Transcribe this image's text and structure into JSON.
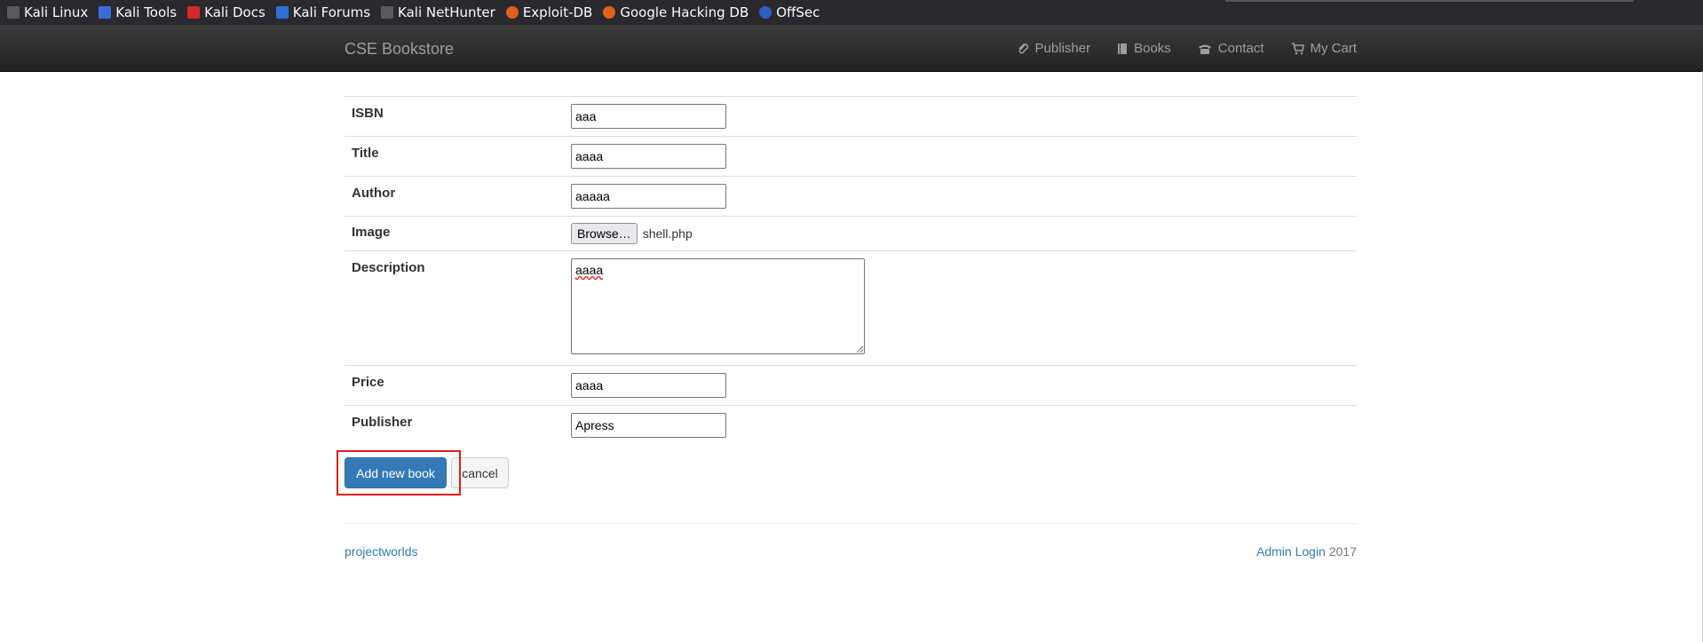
{
  "bookmarks": [
    {
      "label": "Kali Linux",
      "icon": "kali-dragon-icon",
      "color": "#5a5a5a"
    },
    {
      "label": "Kali Tools",
      "icon": "kali-tools-icon",
      "color": "#3b6fd8"
    },
    {
      "label": "Kali Docs",
      "icon": "kali-docs-icon",
      "color": "#d62828"
    },
    {
      "label": "Kali Forums",
      "icon": "kali-forums-icon",
      "color": "#2f6fd6"
    },
    {
      "label": "Kali NetHunter",
      "icon": "kali-dragon-icon",
      "color": "#5a5a5a"
    },
    {
      "label": "Exploit-DB",
      "icon": "exploit-db-icon",
      "color": "#e0601c"
    },
    {
      "label": "Google Hacking DB",
      "icon": "exploit-db-icon",
      "color": "#e0601c"
    },
    {
      "label": "OffSec",
      "icon": "offsec-icon",
      "color": "#2c5fbf"
    }
  ],
  "navbar": {
    "brand": "CSE Bookstore",
    "links": [
      {
        "label": "Publisher",
        "icon": "paperclip-icon"
      },
      {
        "label": "Books",
        "icon": "book-icon"
      },
      {
        "label": "Contact",
        "icon": "phone-icon"
      },
      {
        "label": "My Cart",
        "icon": "cart-icon"
      }
    ]
  },
  "form": {
    "isbn": {
      "label": "ISBN",
      "value": "aaa"
    },
    "title": {
      "label": "Title",
      "value": "aaaa"
    },
    "author": {
      "label": "Author",
      "value": "aaaaa"
    },
    "image": {
      "label": "Image",
      "browse_label": "Browse…",
      "file_name": "shell.php"
    },
    "description": {
      "label": "Description",
      "value": "aaaa"
    },
    "price": {
      "label": "Price",
      "value": "aaaa"
    },
    "publisher": {
      "label": "Publisher",
      "value": "Apress"
    }
  },
  "actions": {
    "add_label": "Add new book",
    "cancel_label": "cancel"
  },
  "footer": {
    "left_link": "projectworlds",
    "admin_link": "Admin Login",
    "year": "2017"
  },
  "colors": {
    "primary": "#337ab7",
    "highlight": "#e31c1c",
    "navbar": "#222222"
  }
}
